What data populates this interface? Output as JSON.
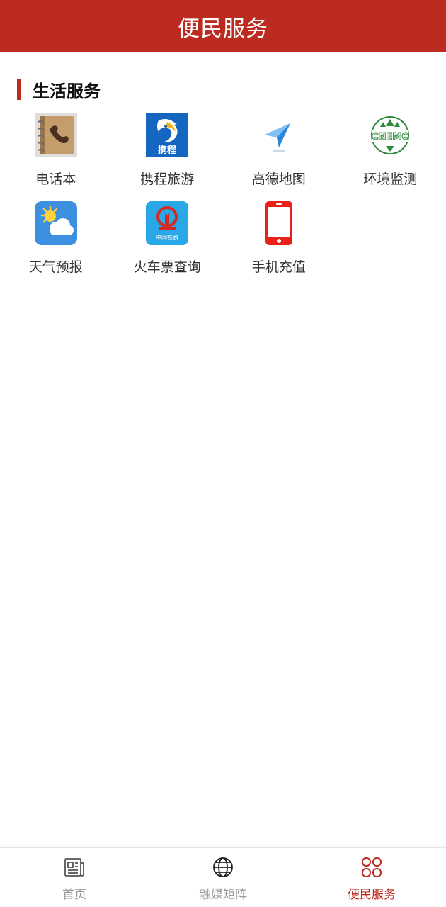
{
  "header": {
    "title": "便民服务"
  },
  "section": {
    "title": "生活服务"
  },
  "services": [
    {
      "label": "电话本",
      "icon": "phonebook-icon"
    },
    {
      "label": "携程旅游",
      "icon": "ctrip-icon",
      "badge": "携程"
    },
    {
      "label": "高德地图",
      "icon": "amap-icon"
    },
    {
      "label": "环境监测",
      "icon": "cnemc-icon",
      "badge": "CNEMC"
    },
    {
      "label": "天气预报",
      "icon": "weather-icon"
    },
    {
      "label": "火车票查询",
      "icon": "railway-icon",
      "badge": "中国铁路"
    },
    {
      "label": "手机充值",
      "icon": "mobile-phone-icon"
    }
  ],
  "tabbar": {
    "tabs": [
      {
        "label": "首页",
        "icon": "newspaper-icon",
        "active": false
      },
      {
        "label": "融媒矩阵",
        "icon": "globe-icon",
        "active": false
      },
      {
        "label": "便民服务",
        "icon": "grid-icon",
        "active": true
      }
    ]
  },
  "colors": {
    "brand": "#bd2a20",
    "inactive": "#999999"
  }
}
